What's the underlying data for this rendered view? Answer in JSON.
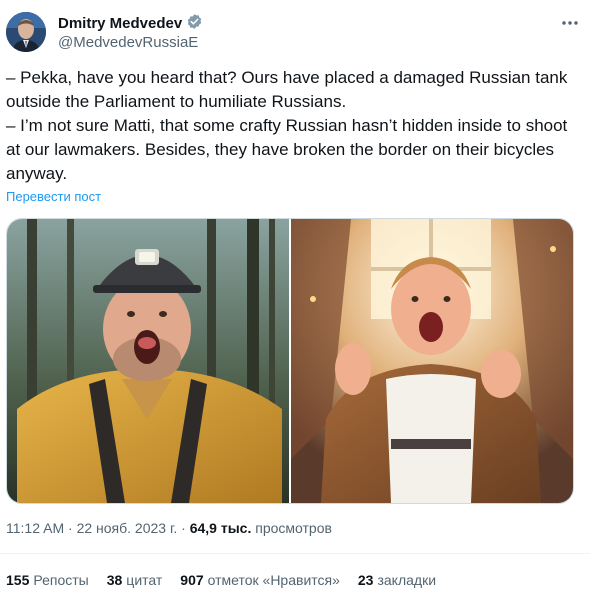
{
  "author": {
    "name": "Dmitry Medvedev",
    "handle": "@MedvedevRussiaE",
    "verified_color": "#829aab"
  },
  "tweet": {
    "lines": [
      "– Pekka, have you heard that? Ours have placed a damaged Russian tank outside the Parliament to humiliate Russians.",
      "– I’m not sure Matti, that some crafty Russian hasn’t hidden inside to shoot at our lawmakers. Besides, they have broken the border on their bicycles anyway."
    ],
    "translate_label": "Перевести пост"
  },
  "meta": {
    "time": "11:12 AM",
    "date": "22 нояб. 2023 г.",
    "views_count": "64,9 тыс.",
    "views_label": "просмотров",
    "separator": "·"
  },
  "stats": {
    "reposts_count": "155",
    "reposts_label": "Репосты",
    "quotes_count": "38",
    "quotes_label": "цитат",
    "likes_count": "907",
    "likes_label": "отметок «Нравится»",
    "bookmarks_count": "23",
    "bookmarks_label": "закладки"
  },
  "colors": {
    "link": "#1d9bf0",
    "secondary": "#536471",
    "primary": "#0f1419"
  }
}
